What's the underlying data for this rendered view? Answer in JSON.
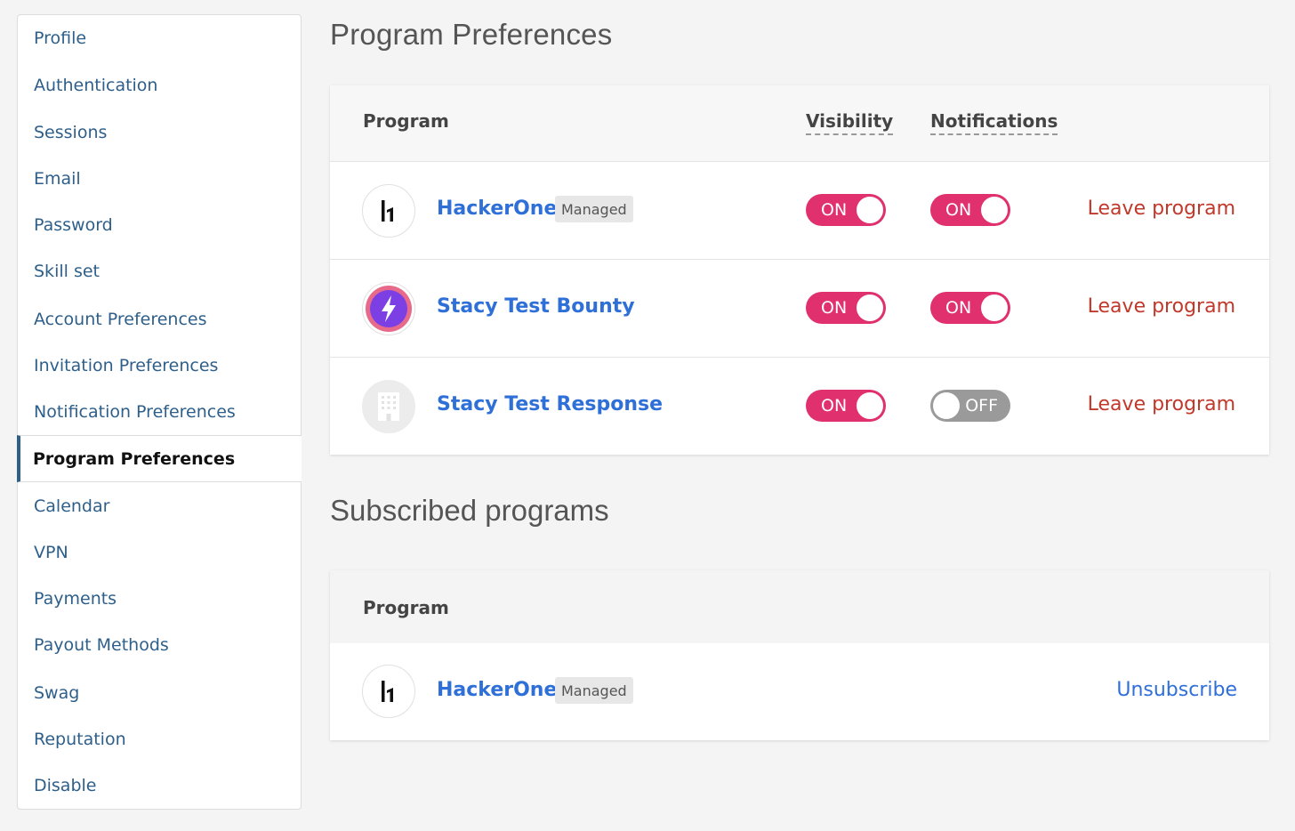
{
  "sidebar": {
    "items": [
      {
        "label": "Profile"
      },
      {
        "label": "Authentication"
      },
      {
        "label": "Sessions"
      },
      {
        "label": "Email"
      },
      {
        "label": "Password"
      },
      {
        "label": "Skill set"
      },
      {
        "label": "Account Preferences"
      },
      {
        "label": "Invitation Preferences"
      },
      {
        "label": "Notification Preferences"
      },
      {
        "label": "Program Preferences",
        "active": true
      },
      {
        "label": "Calendar"
      },
      {
        "label": "VPN"
      },
      {
        "label": "Payments"
      },
      {
        "label": "Payout Methods"
      },
      {
        "label": "Swag"
      },
      {
        "label": "Reputation"
      },
      {
        "label": "Disable"
      }
    ]
  },
  "page_title": "Program Preferences",
  "preferences_table": {
    "headers": {
      "program": "Program",
      "visibility": "Visibility",
      "notifications": "Notifications"
    },
    "rows": [
      {
        "name": "HackerOne",
        "badge": "Managed",
        "logo": "hackerone-logo",
        "visibility": "ON",
        "notifications": "ON",
        "action": "Leave program"
      },
      {
        "name": "Stacy Test Bounty",
        "badge": "",
        "logo": "lightning-bolt-logo",
        "visibility": "ON",
        "notifications": "ON",
        "action": "Leave program"
      },
      {
        "name": "Stacy Test Response",
        "badge": "",
        "logo": "building-placeholder-logo",
        "visibility": "ON",
        "notifications": "OFF",
        "action": "Leave program"
      }
    ]
  },
  "subscribed_title": "Subscribed programs",
  "subscribed_table": {
    "headers": {
      "program": "Program"
    },
    "rows": [
      {
        "name": "HackerOne",
        "badge": "Managed",
        "logo": "hackerone-logo",
        "action": "Unsubscribe"
      }
    ]
  },
  "colors": {
    "toggle_on": "#e0306d",
    "toggle_off": "#9a9a9a",
    "link_blue": "#2f6fd8",
    "leave_red": "#c0392b",
    "sidebar_link": "#2e5f8a"
  }
}
